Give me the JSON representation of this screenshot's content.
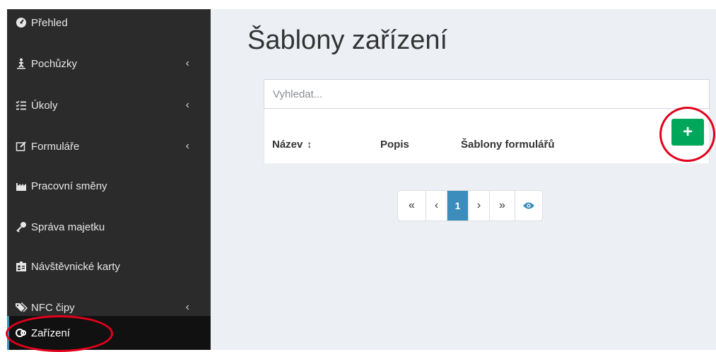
{
  "sidebar": {
    "items": [
      {
        "label": "Přehled",
        "icon": "dashboard-icon",
        "has_submenu": false
      },
      {
        "label": "Pochůzky",
        "icon": "person-walk-icon",
        "has_submenu": true
      },
      {
        "label": "Úkoly",
        "icon": "task-list-icon",
        "has_submenu": true
      },
      {
        "label": "Formuláře",
        "icon": "edit-form-icon",
        "has_submenu": true
      },
      {
        "label": "Pracovní směny",
        "icon": "factory-icon",
        "has_submenu": false
      },
      {
        "label": "Správa majetku",
        "icon": "key-icon",
        "has_submenu": false
      },
      {
        "label": "Návštěvnické karty",
        "icon": "id-card-icon",
        "has_submenu": false
      },
      {
        "label": "NFC čipy",
        "icon": "tags-icon",
        "has_submenu": true
      },
      {
        "label": "Zařízení",
        "icon": "devices-icon",
        "has_submenu": false,
        "active": true
      }
    ],
    "chevron": "‹"
  },
  "main": {
    "title": "Šablony zařízení",
    "search_placeholder": "Vyhledat...",
    "columns": [
      "Název",
      "Popis",
      "Šablony formulářů"
    ],
    "sort_icon": "↕",
    "add_button_label": "+"
  },
  "pagination": {
    "first": "«",
    "prev": "‹",
    "current": "1",
    "next": "›",
    "last": "»"
  },
  "colors": {
    "sidebar_bg": "#2b2b2b",
    "active_accent": "#3c8dbc",
    "add_button": "#00a65a",
    "annotation": "#e3001b"
  }
}
